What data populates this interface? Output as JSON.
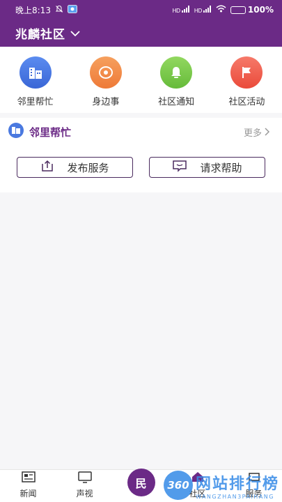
{
  "status_bar": {
    "time": "晚上8:13",
    "signal1": "HD",
    "signal2": "HD",
    "battery": "100%"
  },
  "header": {
    "community": "兆麟社区",
    "brand_color": "#6b2a86"
  },
  "quick_nav": [
    {
      "label": "邻里帮忙",
      "icon": "building-icon",
      "color": "#4a79e0"
    },
    {
      "label": "身边事",
      "icon": "location-pin-icon",
      "color": "#f0884a"
    },
    {
      "label": "社区通知",
      "icon": "bell-icon",
      "color": "#7ccb4b"
    },
    {
      "label": "社区活动",
      "icon": "flag-icon",
      "color": "#f05a4a"
    }
  ],
  "neighbor_section": {
    "title": "邻里帮忙",
    "more": "更多",
    "publish_label": "发布服务",
    "request_label": "请求帮助"
  },
  "tabbar": {
    "tabs": [
      {
        "label": "新闻",
        "icon": "newspaper-icon"
      },
      {
        "label": "声视",
        "icon": "tv-icon"
      },
      {
        "label": "民",
        "icon": "center-icon"
      },
      {
        "label": "社区",
        "icon": "community-icon"
      },
      {
        "label": "服务",
        "icon": "service-icon"
      }
    ]
  },
  "watermark": {
    "badge": "360",
    "cn": "网站排行榜",
    "en": "WANGZHAN3PAIHANG"
  }
}
